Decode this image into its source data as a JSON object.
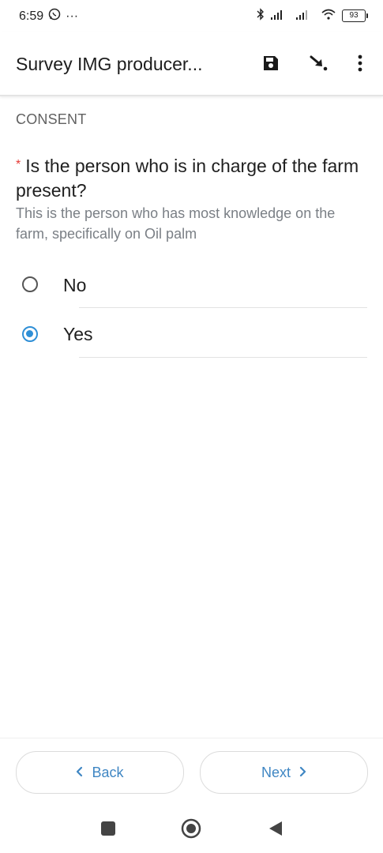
{
  "status_bar": {
    "time": "6:59",
    "dots": "···",
    "battery": "93"
  },
  "app_bar": {
    "title": "Survey IMG producer..."
  },
  "form": {
    "group_label": "CONSENT",
    "required_marker": "*",
    "question": "Is the person who is in charge of the farm present?",
    "hint": "This is the person who has most knowledge on the farm, specifically on Oil palm",
    "options": [
      {
        "label": "No",
        "selected": false
      },
      {
        "label": "Yes",
        "selected": true
      }
    ]
  },
  "navigation": {
    "back_label": "Back",
    "next_label": "Next"
  },
  "colors": {
    "accent": "#2f8fd6",
    "button_text": "#3f86c3",
    "required": "#e53935"
  }
}
